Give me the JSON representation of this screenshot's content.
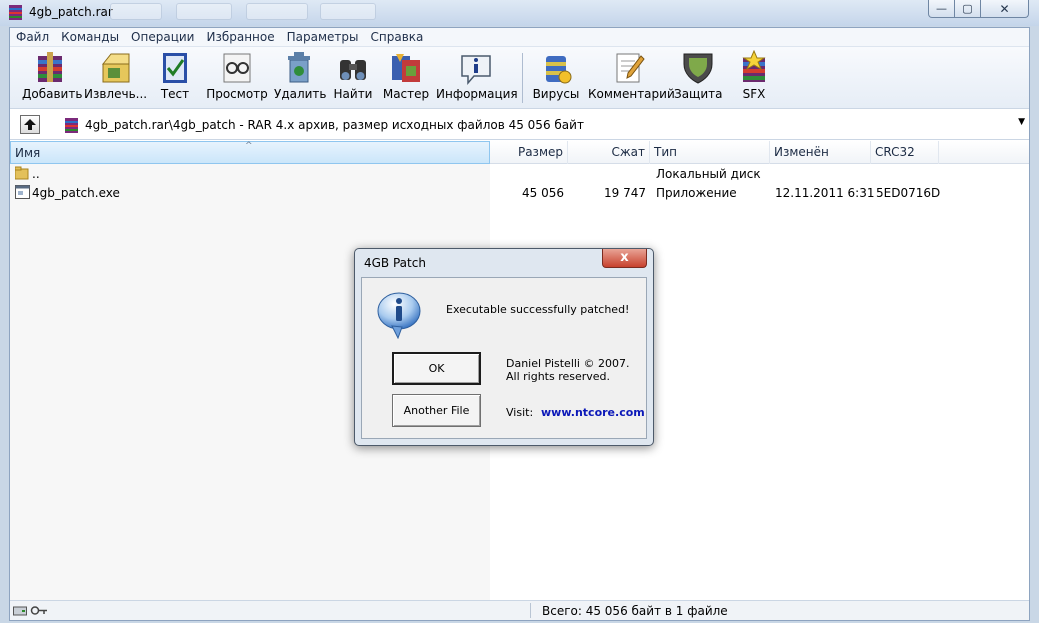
{
  "window": {
    "title": "4gb_patch.rar",
    "controls": {
      "minimize": "—",
      "maximize": "▢",
      "close": "✕"
    }
  },
  "menu": [
    "Файл",
    "Команды",
    "Операции",
    "Избранное",
    "Параметры",
    "Справка"
  ],
  "toolbar": [
    {
      "label": "Добавить",
      "icon": "add-archive-icon"
    },
    {
      "label": "Извлечь...",
      "icon": "extract-icon"
    },
    {
      "label": "Тест",
      "icon": "test-icon"
    },
    {
      "label": "Просмотр",
      "icon": "view-icon"
    },
    {
      "label": "Удалить",
      "icon": "delete-icon"
    },
    {
      "label": "Найти",
      "icon": "find-icon"
    },
    {
      "label": "Мастер",
      "icon": "wizard-icon"
    },
    {
      "label": "Информация",
      "icon": "info-icon"
    },
    {
      "label": "Вирусы",
      "icon": "virus-scan-icon"
    },
    {
      "label": "Комментарий",
      "icon": "comment-icon"
    },
    {
      "label": "Защита",
      "icon": "protect-icon"
    },
    {
      "label": "SFX",
      "icon": "sfx-icon"
    }
  ],
  "address": {
    "path": "4gb_patch.rar\\4gb_patch - RAR 4.x архив, размер исходных файлов 45 056 байт"
  },
  "columns": [
    "Имя",
    "Размер",
    "Сжат",
    "Тип",
    "Изменён",
    "CRC32"
  ],
  "rows": [
    {
      "name": "..",
      "size": "",
      "packed": "",
      "type": "Локальный диск",
      "modified": "",
      "crc": "",
      "icon": "parent-folder-icon"
    },
    {
      "name": "4gb_patch.exe",
      "size": "45 056",
      "packed": "19 747",
      "type": "Приложение",
      "modified": "12.11.2011 6:31",
      "crc": "5ED0716D",
      "icon": "exe-file-icon"
    }
  ],
  "status": {
    "text": "Всего: 45 056 байт в 1 файле"
  },
  "dialog": {
    "title": "4GB Patch",
    "close": "x",
    "message": "Executable successfully patched!",
    "ok_label": "OK",
    "another_label": "Another File",
    "author_line1": "Daniel Pistelli © 2007.",
    "author_line2": "All rights reserved.",
    "visit_label": "Visit:",
    "link_text": "www.ntcore.com"
  },
  "colors": {
    "title_gradient_top": "#dfe9f5",
    "selected_header": "#cbe6fa",
    "dialog_close": "#c7412d",
    "link": "#0b18b8"
  }
}
